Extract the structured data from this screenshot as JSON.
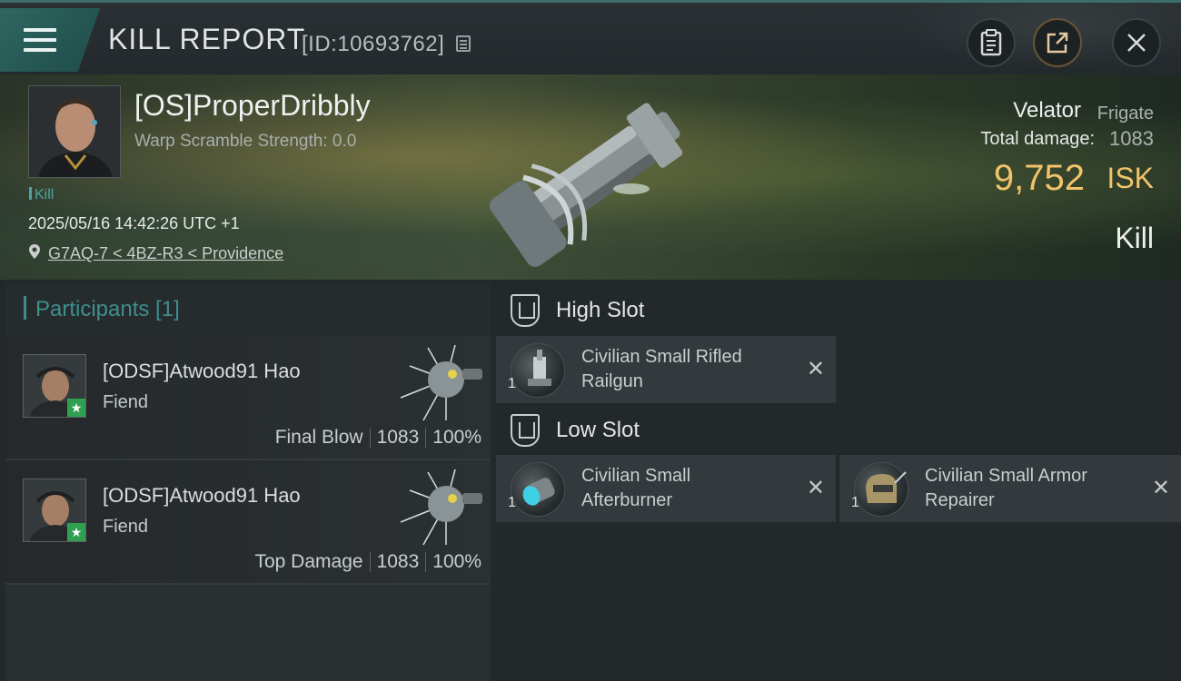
{
  "header": {
    "title": "KILL REPORT",
    "report_id": "[ID:10693762]"
  },
  "victim": {
    "name": "[OS]ProperDribbly",
    "warp_scramble": "Warp Scramble Strength: 0.0",
    "tag": "Kill",
    "datetime": "2025/05/16 14:42:26 UTC +1",
    "location": "G7AQ-7 < 4BZ-R3 < Providence",
    "ship_name": "Velator",
    "ship_class": "Frigate",
    "total_damage_label": "Total damage:",
    "total_damage": "1083",
    "isk_value": "9,752",
    "isk_unit": "ISK",
    "result": "Kill"
  },
  "participants": {
    "title": "Participants [1]",
    "items": [
      {
        "name": "[ODSF]Atwood91 Hao",
        "ship": "Fiend",
        "role": "Final Blow",
        "damage": "1083",
        "percent": "100%"
      },
      {
        "name": "[ODSF]Atwood91 Hao",
        "ship": "Fiend",
        "role": "Top Damage",
        "damage": "1083",
        "percent": "100%"
      }
    ]
  },
  "fitting": {
    "high_slot": {
      "label": "High Slot",
      "modules": [
        {
          "name": "Civilian Small Rifled Railgun",
          "qty": "1"
        }
      ]
    },
    "low_slot": {
      "label": "Low Slot",
      "modules": [
        {
          "name": "Civilian Small Afterburner",
          "qty": "1"
        },
        {
          "name": "Civilian Small Armor Repairer",
          "qty": "1"
        }
      ]
    }
  },
  "colors": {
    "accent": "#3e8f8c",
    "isk": "#f1c36a",
    "kill_tag": "#4fa3a0"
  },
  "icons": [
    "menu-icon",
    "copy-icon",
    "clipboard-icon",
    "share-icon",
    "close-icon",
    "location-pin-icon",
    "star-icon",
    "slot-icon",
    "remove-icon"
  ]
}
